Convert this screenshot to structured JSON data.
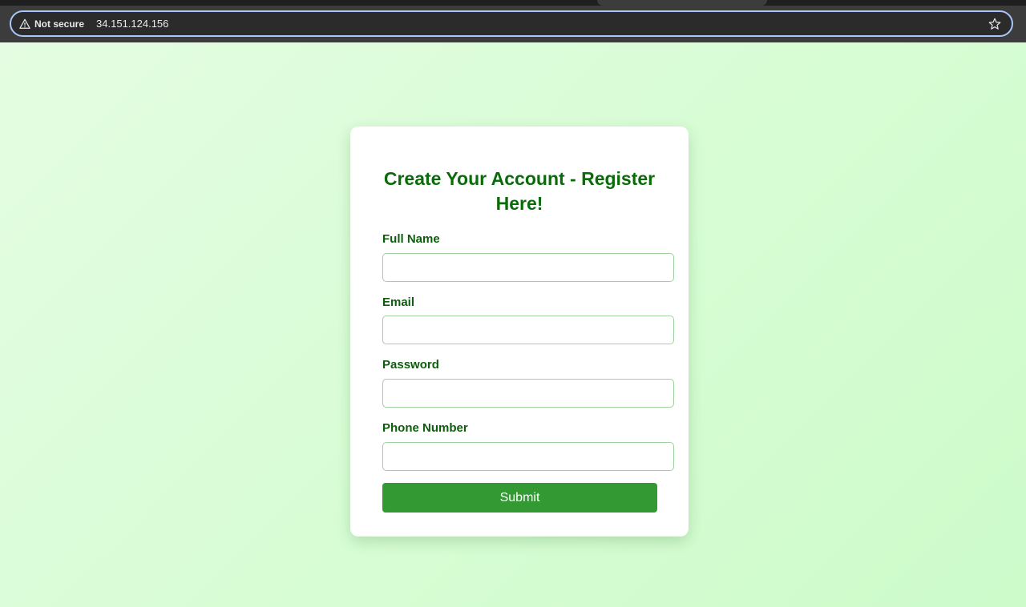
{
  "browser": {
    "security_label": "Not secure",
    "url": "34.151.124.156",
    "icons": {
      "warning": "warning-icon",
      "bookmark": "star-icon"
    },
    "accent_color": "#a8c7fa"
  },
  "form": {
    "title": "Create Your Account - Register Here!",
    "fields": [
      {
        "label": "Full Name",
        "value": "",
        "placeholder": ""
      },
      {
        "label": "Email",
        "value": "",
        "placeholder": ""
      },
      {
        "label": "Password",
        "value": "",
        "placeholder": ""
      },
      {
        "label": "Phone Number",
        "value": "",
        "placeholder": ""
      }
    ],
    "submit_label": "Submit",
    "colors": {
      "title": "#0b6b0b",
      "label": "#0e5c0e",
      "button": "#339933",
      "input_border": "#9ed19e",
      "background": "#d8fdd5"
    }
  }
}
